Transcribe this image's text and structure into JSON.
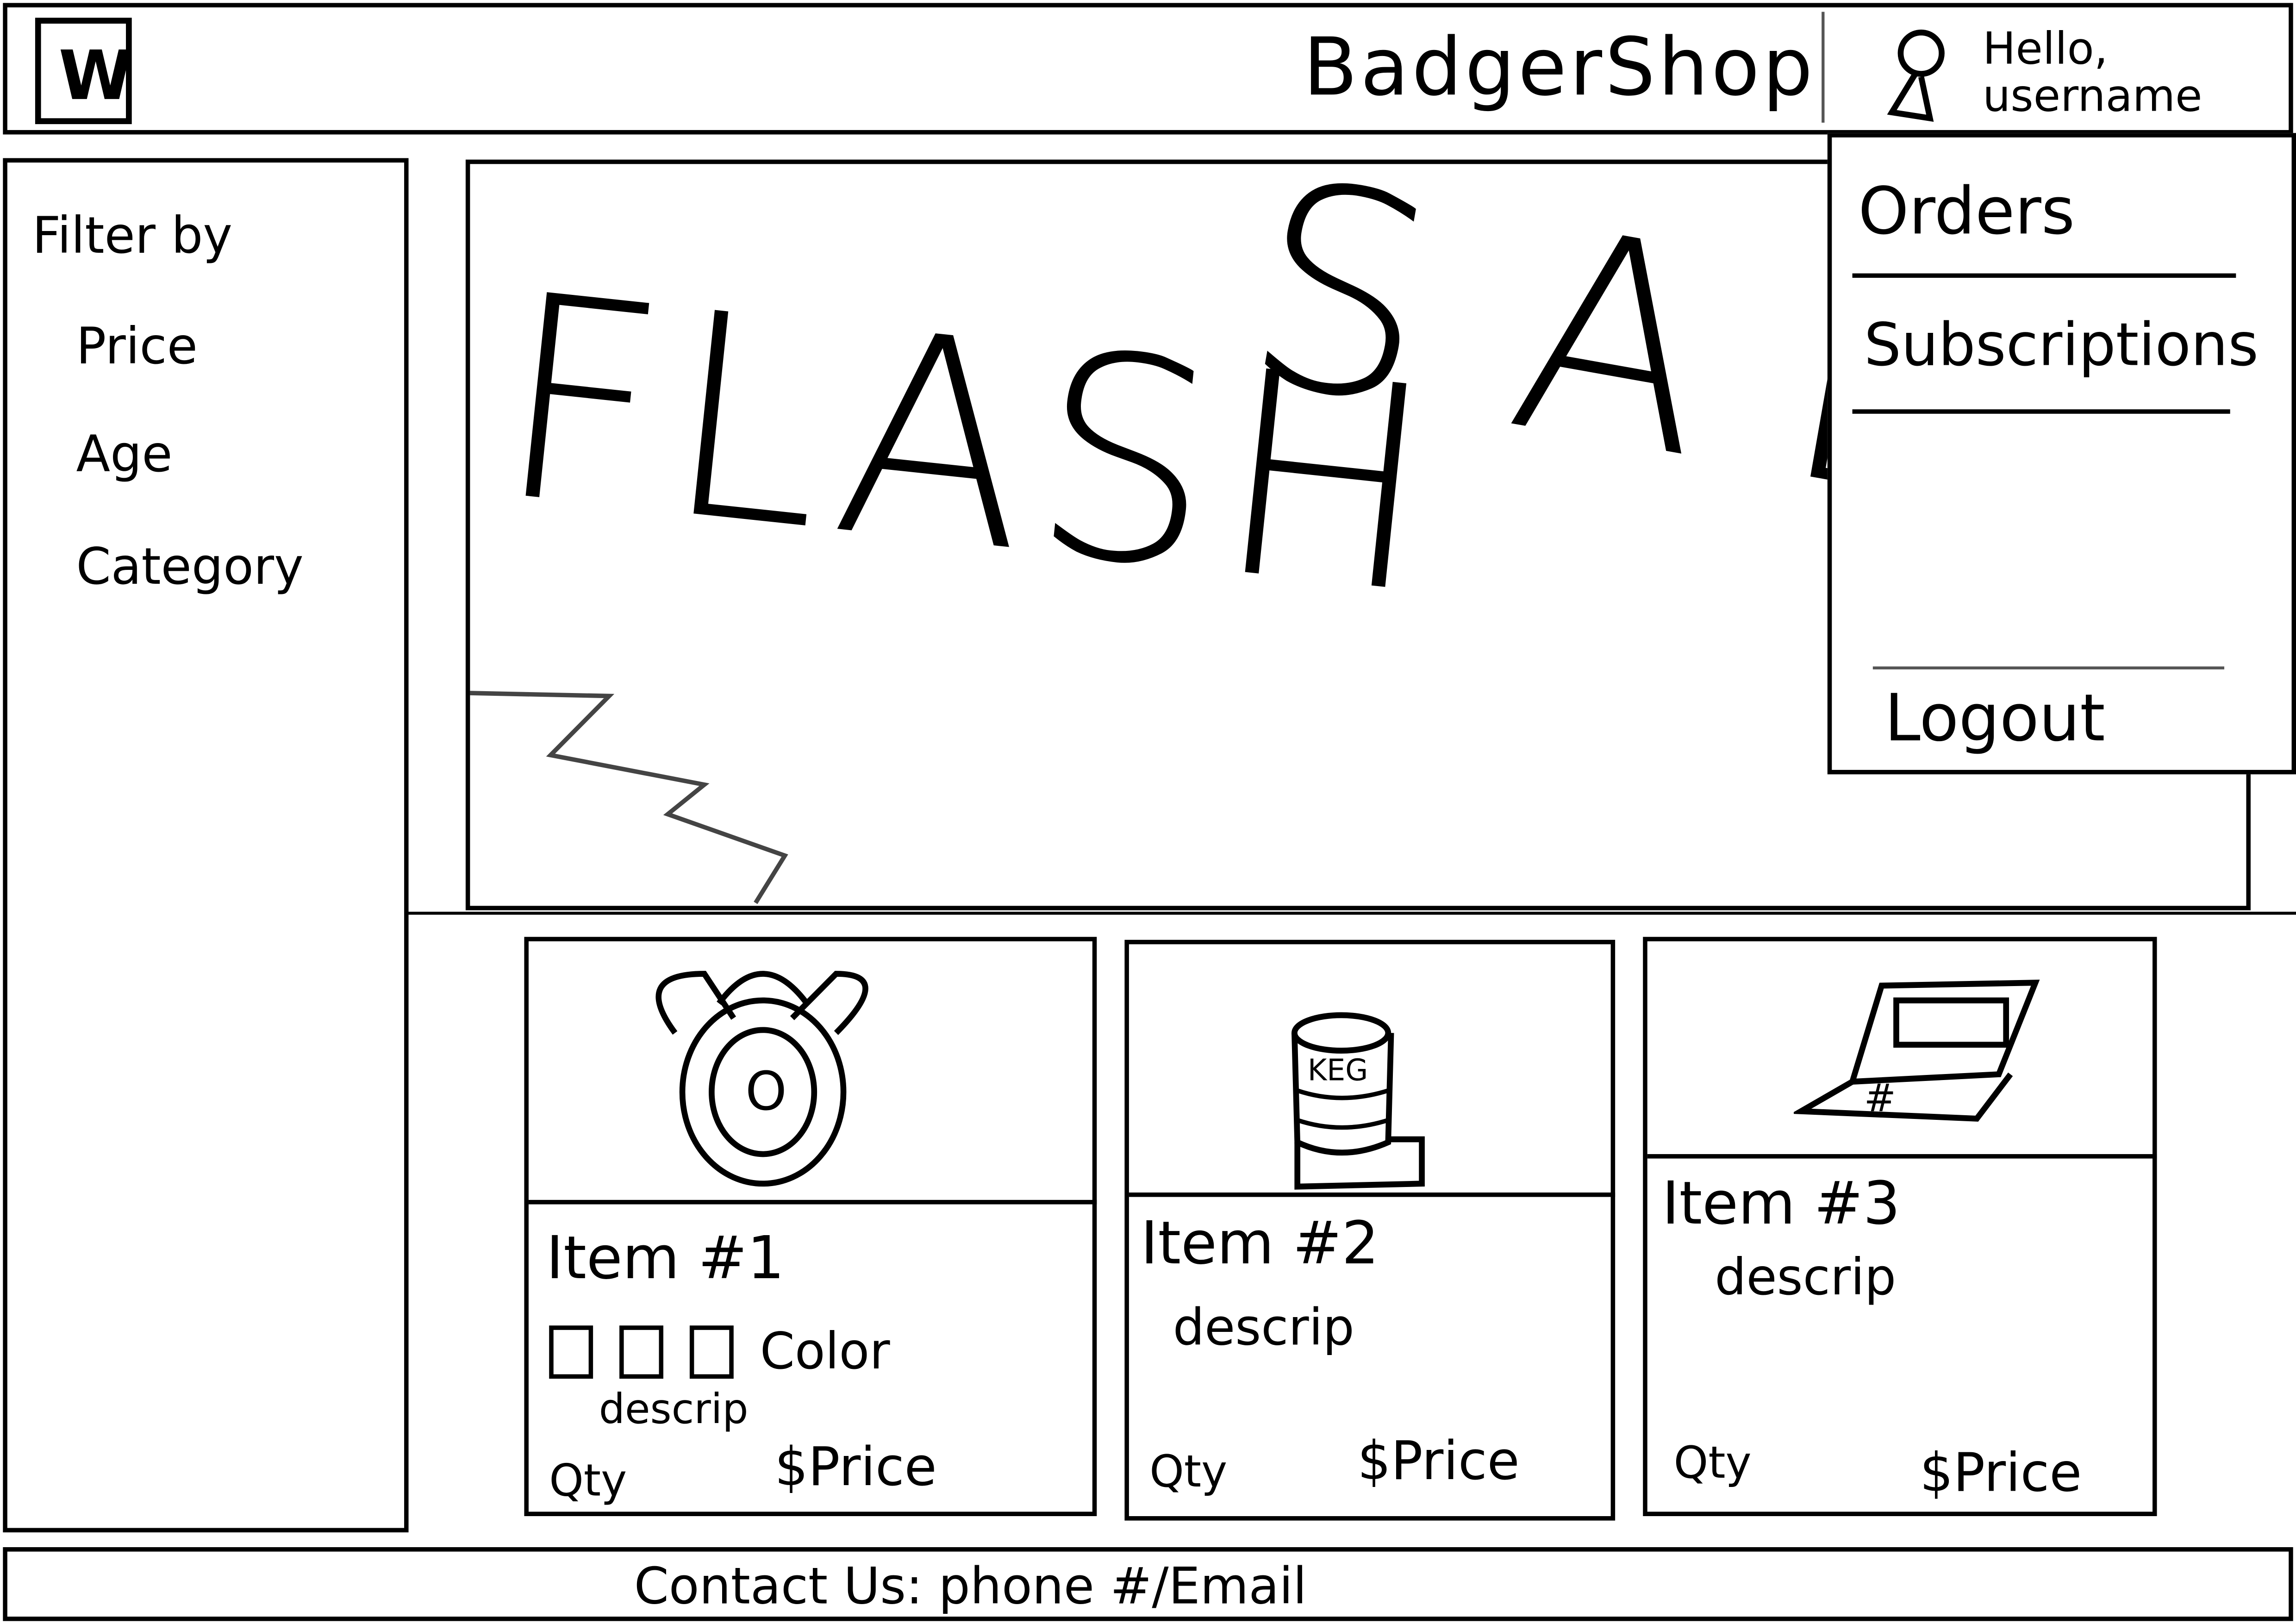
{
  "header": {
    "title": "BadgerShop",
    "greeting_line1": "Hello,",
    "greeting_line2": "username",
    "logo": "W"
  },
  "sidebar": {
    "heading": "Filter by",
    "filters": [
      "Price",
      "Age",
      "Category"
    ]
  },
  "banner": {
    "text_1": "FLASH",
    "text_2": "SALE"
  },
  "user_menu": {
    "items": [
      "Orders",
      "Subscriptions",
      "Logout"
    ]
  },
  "products": [
    {
      "name": "Item #1",
      "swatches_label": "Color",
      "description": "descrip",
      "qty_label": "Qty",
      "price": "$Price",
      "image": "backpack",
      "image_text": "O"
    },
    {
      "name": "Item #2",
      "description": "descrip",
      "qty_label": "Qty",
      "price": "$Price",
      "image": "keg",
      "image_text": "KEG"
    },
    {
      "name": "Item #3",
      "description": "descrip",
      "qty_label": "Qty",
      "price": "$Price",
      "image": "laptop",
      "image_text": "#"
    }
  ],
  "footer": {
    "contact": "Contact Us: phone #/Email"
  }
}
